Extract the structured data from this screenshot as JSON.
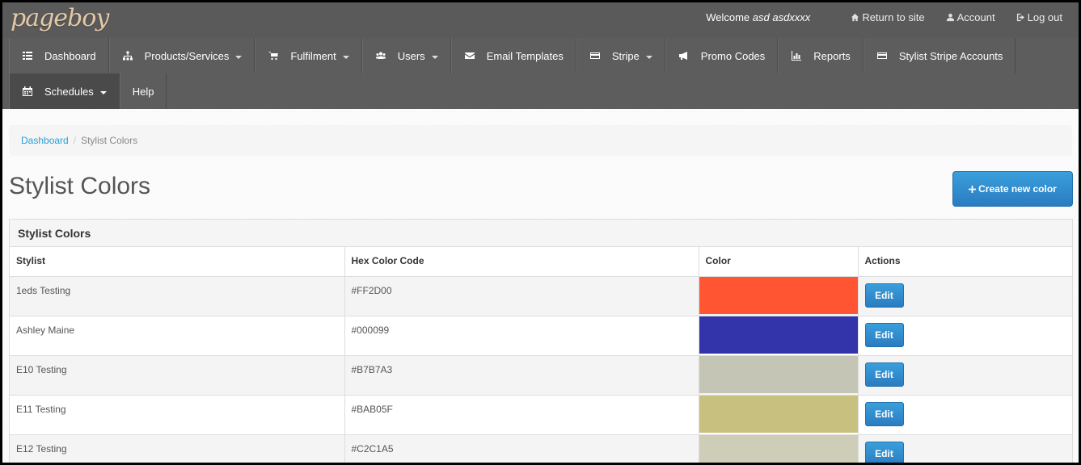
{
  "brand": {
    "logo": "pageboy"
  },
  "topbar": {
    "welcome_prefix": "Welcome",
    "welcome_user": "asd asdxxxx",
    "return_label": "Return to site",
    "account_label": "Account",
    "logout_label": "Log out"
  },
  "nav": {
    "row1": [
      {
        "label": "Dashboard",
        "icon": "list-icon",
        "caret": false
      },
      {
        "label": "Products/Services",
        "icon": "sitemap-icon",
        "caret": true
      },
      {
        "label": "Fulfilment",
        "icon": "cart-icon",
        "caret": true
      },
      {
        "label": "Users",
        "icon": "users-icon",
        "caret": true
      },
      {
        "label": "Email Templates",
        "icon": "envelope-icon",
        "caret": false
      },
      {
        "label": "Stripe",
        "icon": "credit-card-icon",
        "caret": true
      },
      {
        "label": "Promo Codes",
        "icon": "bullhorn-icon",
        "caret": false
      },
      {
        "label": "Reports",
        "icon": "bar-chart-icon",
        "caret": false
      },
      {
        "label": "Stylist Stripe Accounts",
        "icon": "credit-card-icon",
        "caret": false
      }
    ],
    "row2": [
      {
        "label": "Schedules",
        "icon": "calendar-icon",
        "caret": true,
        "active": true
      },
      {
        "label": "Help",
        "icon": "",
        "caret": false
      }
    ]
  },
  "breadcrumb": {
    "home": "Dashboard",
    "separator": "/",
    "current": "Stylist Colors"
  },
  "page": {
    "title": "Stylist Colors",
    "create_button": "Create new color"
  },
  "panel": {
    "title": "Stylist Colors",
    "columns": [
      "Stylist",
      "Hex Color Code",
      "Color",
      "Actions"
    ],
    "edit_label": "Edit",
    "rows": [
      {
        "stylist": "1eds Testing",
        "hex": "#FF2D00",
        "swatch": "#FF5533"
      },
      {
        "stylist": "Ashley Maine",
        "hex": "#000099",
        "swatch": "#3333AA"
      },
      {
        "stylist": "E10 Testing",
        "hex": "#B7B7A3",
        "swatch": "#C5C5B5"
      },
      {
        "stylist": "E11 Testing",
        "hex": "#BAB05F",
        "swatch": "#C8C07F"
      },
      {
        "stylist": "E12 Testing",
        "hex": "#C2C1A5",
        "swatch": "#CECDB7"
      }
    ]
  },
  "colors": {
    "accent": "#2a9fd6",
    "button": "#2a7cc0",
    "nav_bg": "#5d5d5d"
  }
}
